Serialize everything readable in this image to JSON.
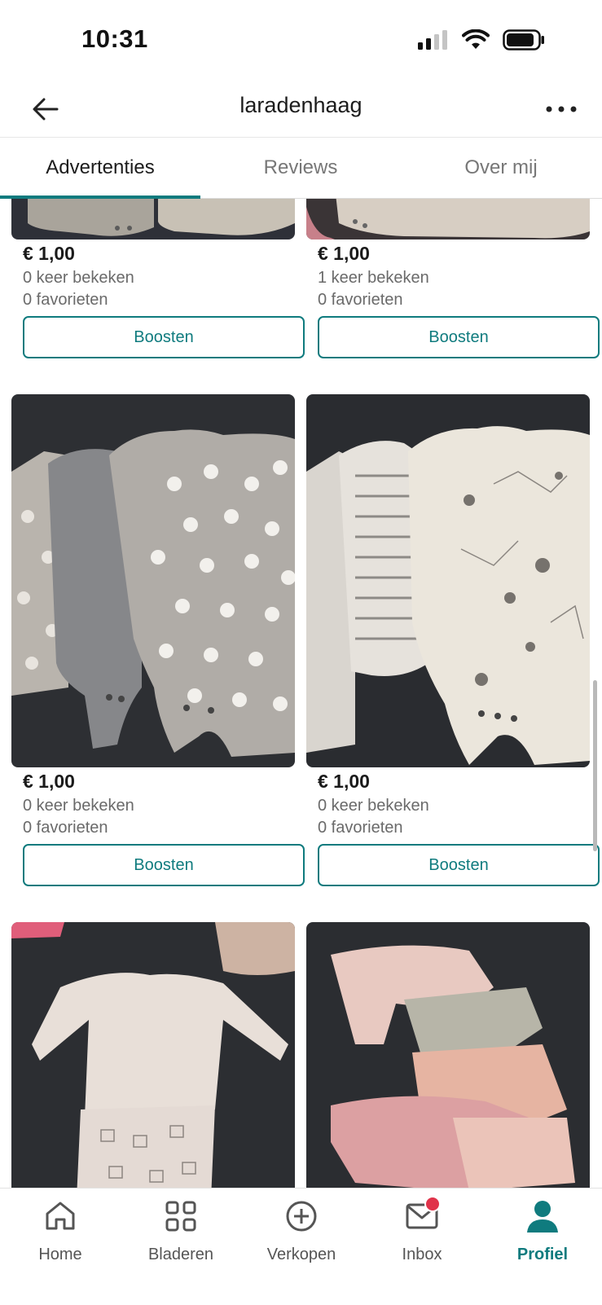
{
  "status": {
    "time": "10:31"
  },
  "header": {
    "title": "laradenhaag"
  },
  "tabs": [
    {
      "label": "Advertenties",
      "active": true
    },
    {
      "label": "Reviews",
      "active": false
    },
    {
      "label": "Over mij",
      "active": false
    }
  ],
  "listings": [
    {
      "price": "€ 1,00",
      "views": "0 keer bekeken",
      "favorites": "0 favorieten",
      "button": "Boosten",
      "image": "gray knitted baby outfit"
    },
    {
      "price": "€ 1,00",
      "views": "1 keer bekeken",
      "favorites": "0 favorieten",
      "button": "Boosten",
      "image": "beige baby bodysuit"
    },
    {
      "price": "€ 1,00",
      "views": "0 keer bekeken",
      "favorites": "0 favorieten",
      "button": "Boosten",
      "image": "gray baby bodysuits with sheep print"
    },
    {
      "price": "€ 1,00",
      "views": "0 keer bekeken",
      "favorites": "0 favorieten",
      "button": "Boosten",
      "image": "cream baby bodysuits with stars print"
    },
    {
      "image": "pink baby long-sleeve outfit"
    },
    {
      "image": "pink and gray baby pants"
    }
  ],
  "bottom_nav": [
    {
      "label": "Home",
      "icon": "home-icon",
      "active": false
    },
    {
      "label": "Bladeren",
      "icon": "grid-icon",
      "active": false
    },
    {
      "label": "Verkopen",
      "icon": "plus-circle-icon",
      "active": false
    },
    {
      "label": "Inbox",
      "icon": "mail-icon",
      "active": false,
      "badge": true
    },
    {
      "label": "Profiel",
      "icon": "profile-icon",
      "active": true
    }
  ],
  "colors": {
    "accent": "#0f7b7e",
    "badge": "#e0334a"
  }
}
